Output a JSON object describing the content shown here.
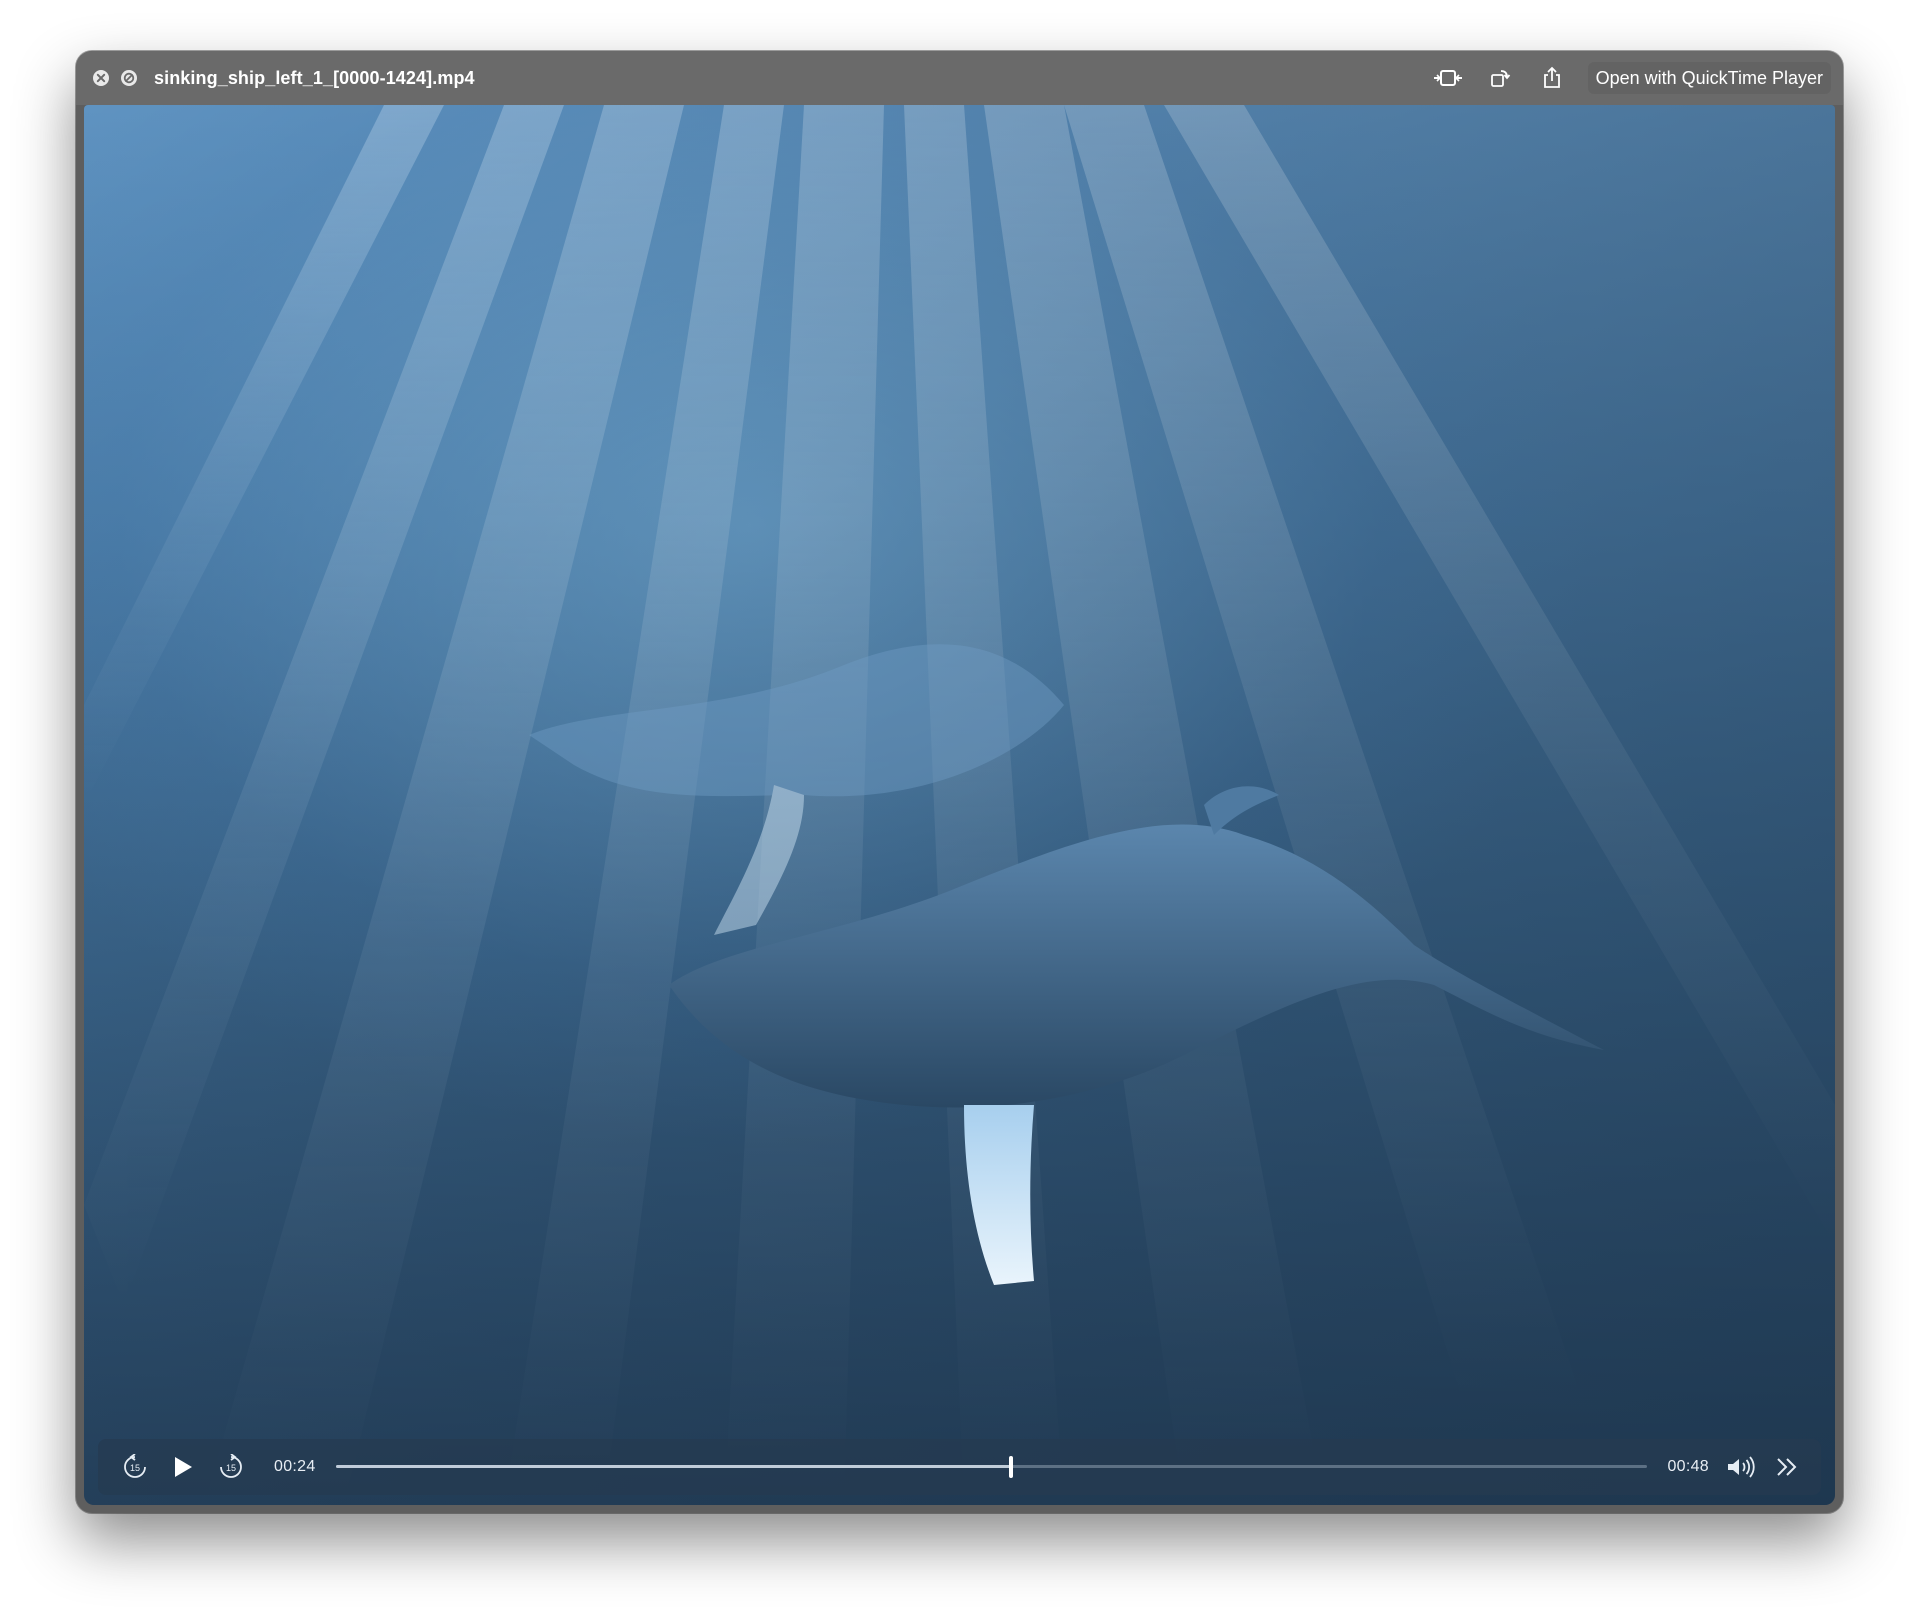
{
  "window": {
    "title": "sinking_ship_left_1_[0000-1424].mp4",
    "open_with_label": "Open with QuickTime Player",
    "icons": {
      "close": "close-circle-icon",
      "no_entry": "prohibited-icon",
      "trim": "trim-icon",
      "rotate": "rotate-icon",
      "share": "share-icon"
    }
  },
  "player": {
    "current_time": "00:24",
    "total_time": "00:48",
    "progress": 0.515,
    "skip_back_label": "15",
    "skip_forward_label": "15",
    "icons": {
      "skip_back": "skip-back-15-icon",
      "play": "play-icon",
      "skip_forward": "skip-forward-15-icon",
      "volume": "volume-icon",
      "more": "chevrons-right-icon"
    }
  },
  "colors": {
    "titlebar": "#6a6a6a",
    "water_top": "#5f93c1",
    "water_bottom": "#2c4d6d",
    "controls_bg": "#263a50"
  }
}
